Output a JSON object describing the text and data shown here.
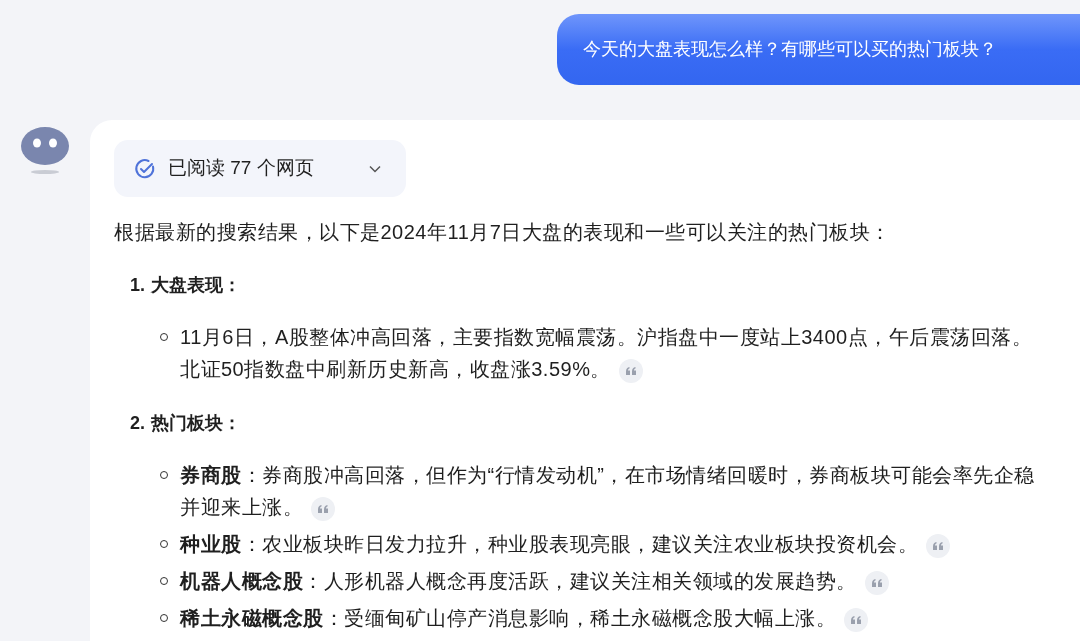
{
  "user_message": "今天的大盘表现怎么样？有哪些可以买的热门板块？",
  "reply": {
    "sources": {
      "label": "已阅读 77 个网页",
      "expanded": false
    },
    "intro": "根据最新的搜索结果，以下是2024年11月7日大盘的表现和一些可以关注的热门板块：",
    "sections": [
      {
        "number": "1.",
        "title": "大盘表现：",
        "items": [
          {
            "text": "11月6日，A股整体冲高回落，主要指数宽幅震荡。沪指盘中一度站上3400点，午后震荡回落。北证50指数盘中刷新历史新高，收盘涨3.59%。",
            "cited": true
          }
        ]
      },
      {
        "number": "2.",
        "title": "热门板块：",
        "items": [
          {
            "text": "**券商股**：券商股冲高回落，但作为“行情发动机”，在市场情绪回暖时，券商板块可能会率先企稳并迎来上涨。",
            "cited": true
          },
          {
            "text": "**种业股**：农业板块昨日发力拉升，种业股表现亮眼，建议关注农业板块投资机会。",
            "cited": true
          },
          {
            "text": "**机器人概念股**：人形机器人概念再度活跃，建议关注相关领域的发展趋势。",
            "cited": true
          },
          {
            "text": "**稀土永磁概念股**：受缅甸矿山停产消息影响，稀土永磁概念股大幅上涨。",
            "cited": true
          }
        ]
      }
    ]
  }
}
